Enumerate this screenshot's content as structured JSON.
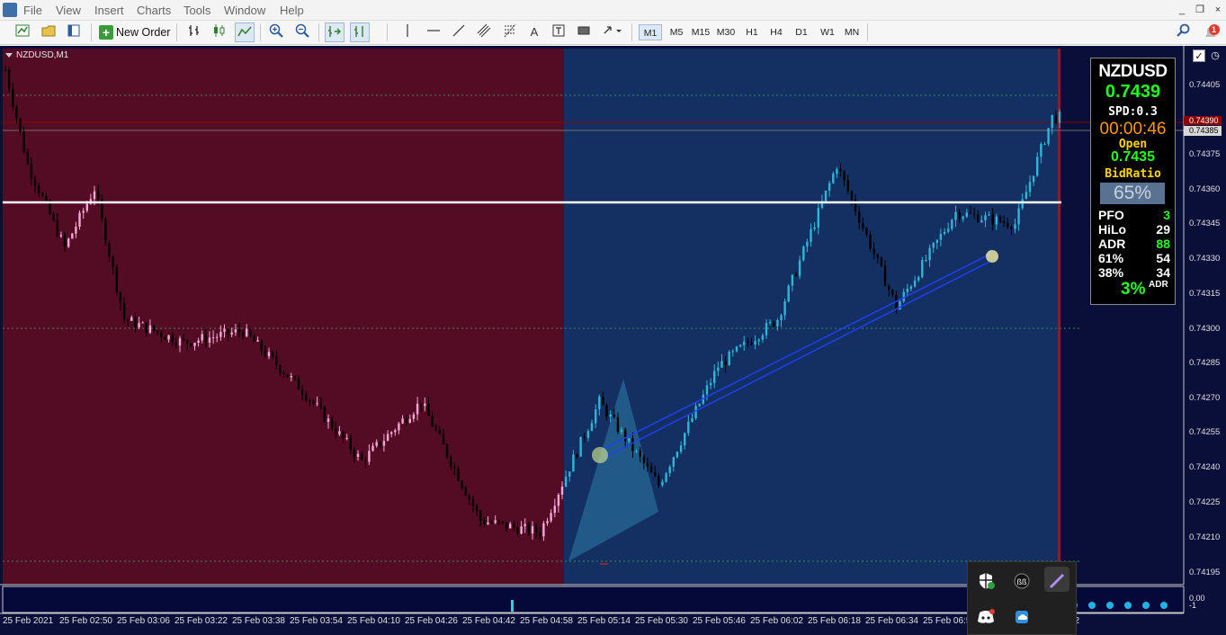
{
  "menu": {
    "items": [
      "File",
      "View",
      "Insert",
      "Charts",
      "Tools",
      "Window",
      "Help"
    ],
    "window_controls": [
      "_",
      "❐",
      "×"
    ]
  },
  "toolbar": {
    "new_order_label": "New Order",
    "timeframes": [
      "M1",
      "M5",
      "M15",
      "M30",
      "H1",
      "H4",
      "D1",
      "W1",
      "MN"
    ],
    "active_timeframe": "M1",
    "notification_count": "1"
  },
  "chart": {
    "title": "NZDUSD,M1",
    "y_ticks": [
      "0.74405",
      "0.74390",
      "0.74385",
      "0.74375",
      "0.74360",
      "0.74345",
      "0.74330",
      "0.74315",
      "0.74300",
      "0.74285",
      "0.74270",
      "0.74255",
      "0.74240",
      "0.74225",
      "0.74210",
      "0.74195"
    ],
    "ask_label": "0.74390",
    "bid_label": "0.74385",
    "x_ticks": [
      "25 Feb 2021",
      "25 Feb 02:50",
      "25 Feb 03:06",
      "25 Feb 03:22",
      "25 Feb 03:38",
      "25 Feb 03:54",
      "25 Feb 04:10",
      "25 Feb 04:26",
      "25 Feb 04:42",
      "25 Feb 04:58",
      "25 Feb 05:14",
      "25 Feb 05:30",
      "25 Feb 05:46",
      "25 Feb 06:02",
      "25 Feb 06:18",
      "25 Feb 06:34",
      "25 Feb 06:5",
      "22"
    ],
    "subwindow_labels": [
      "0.00",
      "-1"
    ],
    "colors": {
      "left_bg": "#540c24",
      "right_bg": "#143063",
      "outer_bg": "#0a0f3a",
      "bull_left": "#f2a7d4",
      "bull_right": "#2fb6d6",
      "bear": "#000000",
      "ask_line": "#8b0000",
      "level_line": "#ffffff",
      "trend_line": "#1f3fff"
    }
  },
  "chart_data": {
    "type": "candlestick",
    "symbol": "NZDUSD",
    "timeframe": "M1",
    "ylim": [
      0.74188,
      0.74414
    ],
    "x_start": "25 Feb 02:34",
    "x_end": "25 Feb 07:22",
    "horizontal_level": 0.74355,
    "close_path": [
      {
        "time": "02:34",
        "price": 0.74405
      },
      {
        "time": "02:40",
        "price": 0.74365
      },
      {
        "time": "02:50",
        "price": 0.7433
      },
      {
        "time": "02:58",
        "price": 0.74355
      },
      {
        "time": "03:06",
        "price": 0.743
      },
      {
        "time": "03:22",
        "price": 0.7429
      },
      {
        "time": "03:38",
        "price": 0.74295
      },
      {
        "time": "03:54",
        "price": 0.7427
      },
      {
        "time": "04:10",
        "price": 0.7424
      },
      {
        "time": "04:26",
        "price": 0.74265
      },
      {
        "time": "04:42",
        "price": 0.74215
      },
      {
        "time": "04:58",
        "price": 0.7421
      },
      {
        "time": "05:14",
        "price": 0.74265
      },
      {
        "time": "05:30",
        "price": 0.7423
      },
      {
        "time": "05:46",
        "price": 0.7428
      },
      {
        "time": "06:02",
        "price": 0.743
      },
      {
        "time": "06:18",
        "price": 0.74365
      },
      {
        "time": "06:34",
        "price": 0.74305
      },
      {
        "time": "06:50",
        "price": 0.74345
      },
      {
        "time": "07:06",
        "price": 0.7434
      },
      {
        "time": "07:16",
        "price": 0.74385
      }
    ]
  },
  "info_panel": {
    "symbol": "NZDUSD",
    "price": "0.7439",
    "spread": "SPD:0.3",
    "timer": "00:00:46",
    "open_label": "Open",
    "open_value": "0.7435",
    "bid_ratio_label": "BidRatio",
    "bid_ratio_value": "65%",
    "rows": [
      {
        "label": "PFO",
        "value": "3",
        "color": "#22ff22"
      },
      {
        "label": "HiLo",
        "value": "29",
        "color": "#ffffff"
      },
      {
        "label": "ADR",
        "value": "88",
        "color": "#22ff22"
      },
      {
        "label": "61%",
        "value": "54",
        "color": "#ffffff"
      },
      {
        "label": "38%",
        "value": "34",
        "color": "#ffffff"
      }
    ],
    "adr_pct": "3%",
    "adr_pct_label": "ADR"
  },
  "tray": {
    "icons": [
      "security-shield-icon",
      "app-icon",
      "pen-icon",
      "discord-icon",
      "cloud-icon"
    ]
  }
}
